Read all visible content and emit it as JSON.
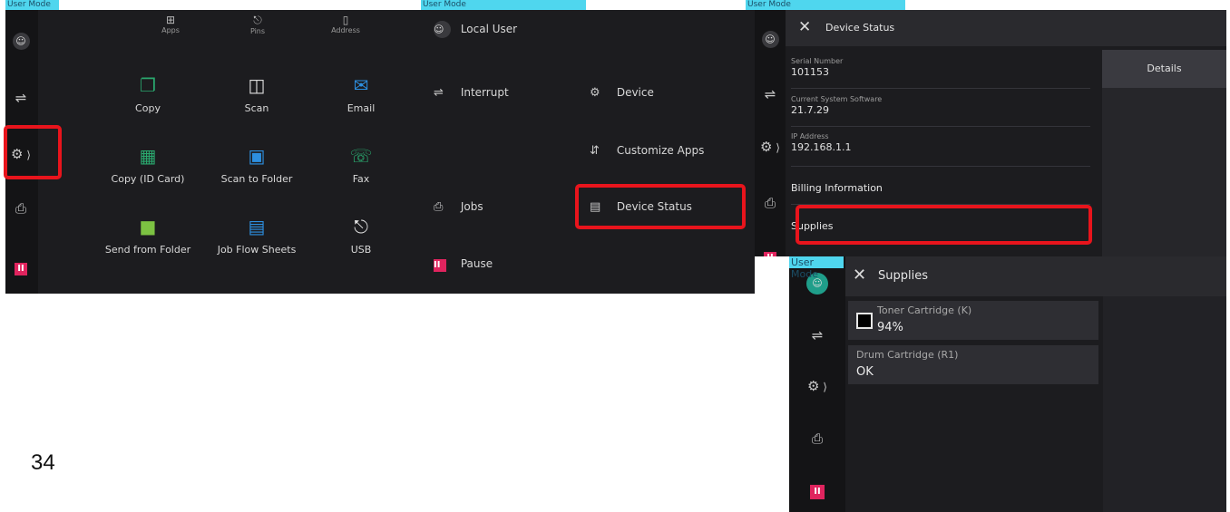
{
  "common": {
    "user_mode": "User Mode"
  },
  "panel1": {
    "tabs": [
      {
        "label": "Apps",
        "icon": "apps-grid-icon"
      },
      {
        "label": "Pins",
        "icon": "pin-icon"
      },
      {
        "label": "Address",
        "icon": "address-book-icon"
      }
    ],
    "apps": [
      {
        "label": "Copy",
        "icon": "copy-icon"
      },
      {
        "label": "Scan",
        "icon": "scan-icon"
      },
      {
        "label": "Email",
        "icon": "email-icon"
      },
      {
        "label": "Copy (ID Card)",
        "icon": "id-card-icon"
      },
      {
        "label": "Scan to Folder",
        "icon": "scan-to-folder-icon"
      },
      {
        "label": "Fax",
        "icon": "fax-icon"
      },
      {
        "label": "Send from Folder",
        "icon": "folder-icon"
      },
      {
        "label": "Job Flow Sheets",
        "icon": "job-flow-icon"
      },
      {
        "label": "USB",
        "icon": "usb-icon"
      }
    ]
  },
  "panel2": {
    "user_label": "Local User",
    "interrupt": "Interrupt",
    "device": "Device",
    "customize_apps": "Customize Apps",
    "jobs": "Jobs",
    "device_status": "Device Status",
    "pause": "Pause"
  },
  "panel3": {
    "title": "Device Status",
    "serial_label": "Serial Number",
    "serial_value": "101153",
    "software_label": "Current System Software",
    "software_value": "21.7.29",
    "ip_label": "IP Address",
    "ip_value": "192.168.1.1",
    "details": "Details",
    "billing": "Billing Information",
    "supplies": "Supplies"
  },
  "panel4": {
    "title": "Supplies",
    "items": [
      {
        "name": "Toner Cartridge (K)",
        "value": "94%"
      },
      {
        "name": "Drum Cartridge (R1)",
        "value": "OK"
      }
    ]
  },
  "page_number": "34",
  "colors": {
    "highlight": "#e8141c",
    "user_mode_banner": "#4fd6ee",
    "pause": "#e0245e",
    "folder_green": "#7cc242",
    "app_blue": "#2d8fe0"
  }
}
